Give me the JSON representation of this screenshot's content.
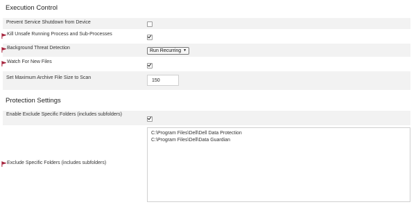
{
  "execution_control": {
    "title": "Execution Control",
    "rows": {
      "prevent_shutdown": {
        "label": "Prevent Service Shutdown from Device",
        "checked": false
      },
      "kill_unsafe": {
        "label": "Kill Unsafe Running Process and Sub-Processes",
        "checked": true
      },
      "background_threat": {
        "label": "Background Threat Detection",
        "value": "Run Recurring"
      },
      "watch_new_files": {
        "label": "Watch For New Files",
        "checked": true
      },
      "max_archive": {
        "label": "Set Maximum Archive File Size to Scan",
        "value": "150"
      }
    }
  },
  "protection_settings": {
    "title": "Protection Settings",
    "rows": {
      "enable_exclude": {
        "label": "Enable Exclude Specific Folders (includes subfolders)",
        "checked": true
      },
      "exclude_folders": {
        "label": "Exclude Specific Folders (includes subfolders)",
        "lines": [
          "C:\\Program Files\\Dell\\Dell Data Protection",
          "C:\\Program Files\\Dell\\Data Guardian"
        ]
      }
    }
  },
  "colors": {
    "flag_icon": "#a6263e",
    "row_shade": "#f2f2f2"
  },
  "icons": {
    "flag": "red-flag-icon",
    "dropdown": "chevron-down-icon"
  }
}
